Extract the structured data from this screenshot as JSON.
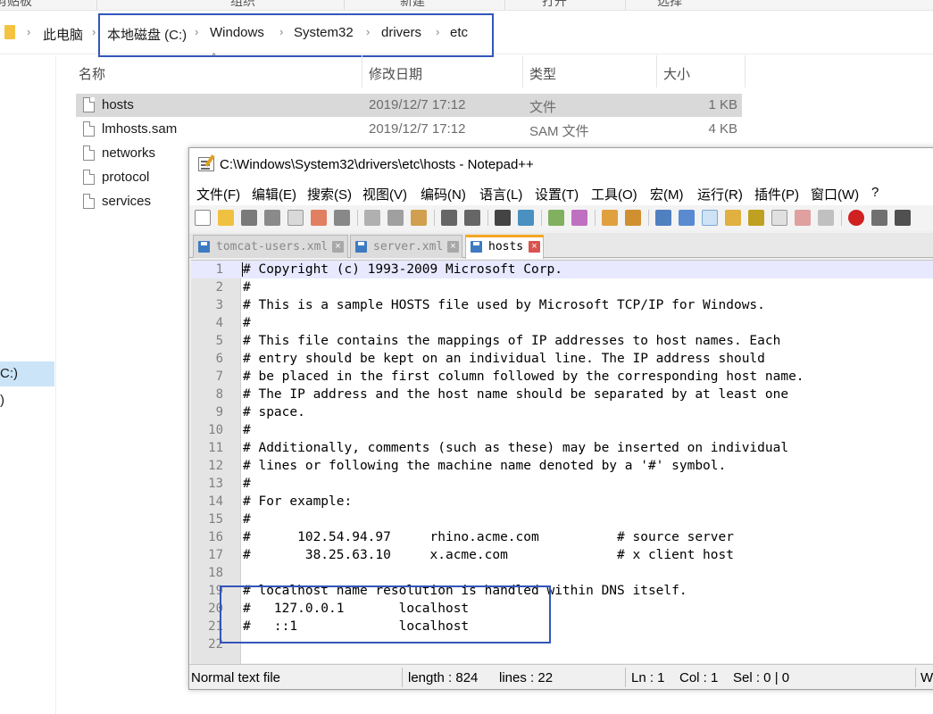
{
  "explorer": {
    "ribbon": [
      "剪贴板",
      "组织",
      "新建",
      "打开",
      "选择"
    ],
    "breadcrumb": [
      "此电脑",
      "本地磁盘 (C:)",
      "Windows",
      "System32",
      "drivers",
      "etc"
    ],
    "nav_selected": "C:)",
    "nav_item2": ")",
    "columns": {
      "name": "名称",
      "date": "修改日期",
      "type": "类型",
      "size": "大小"
    },
    "files": [
      {
        "name": "hosts",
        "date": "2019/12/7 17:12",
        "type": "文件",
        "size": "1 KB"
      },
      {
        "name": "lmhosts.sam",
        "date": "2019/12/7 17:12",
        "type": "SAM 文件",
        "size": "4 KB"
      },
      {
        "name": "networks",
        "date": "",
        "type": "",
        "size": ""
      },
      {
        "name": "protocol",
        "date": "",
        "type": "",
        "size": ""
      },
      {
        "name": "services",
        "date": "",
        "type": "",
        "size": ""
      }
    ]
  },
  "notepad": {
    "title": "C:\\Windows\\System32\\drivers\\etc\\hosts - Notepad++",
    "menu": [
      "文件(F)",
      "编辑(E)",
      "搜索(S)",
      "视图(V)",
      "编码(N)",
      "语言(L)",
      "设置(T)",
      "工具(O)",
      "宏(M)",
      "运行(R)",
      "插件(P)",
      "窗口(W)",
      "?"
    ],
    "tabs": [
      "tomcat-users.xml",
      "server.xml",
      "hosts"
    ],
    "lines": [
      "# Copyright (c) 1993-2009 Microsoft Corp.",
      "#",
      "# This is a sample HOSTS file used by Microsoft TCP/IP for Windows.",
      "#",
      "# This file contains the mappings of IP addresses to host names. Each",
      "# entry should be kept on an individual line. The IP address should",
      "# be placed in the first column followed by the corresponding host name.",
      "# The IP address and the host name should be separated by at least one",
      "# space.",
      "#",
      "# Additionally, comments (such as these) may be inserted on individual",
      "# lines or following the machine name denoted by a '#' symbol.",
      "#",
      "# For example:",
      "#",
      "#      102.54.94.97     rhino.acme.com          # source server",
      "#       38.25.63.10     x.acme.com              # x client host",
      "",
      "# localhost name resolution is handled within DNS itself.",
      "#   127.0.0.1       localhost",
      "#   ::1             localhost",
      ""
    ],
    "status": {
      "file_type": "Normal text file",
      "length": "length : 824",
      "lines": "lines : 22",
      "ln": "Ln : 1",
      "col": "Col : 1",
      "sel": "Sel : 0 | 0",
      "eol": "Windows (CR LF)"
    }
  }
}
